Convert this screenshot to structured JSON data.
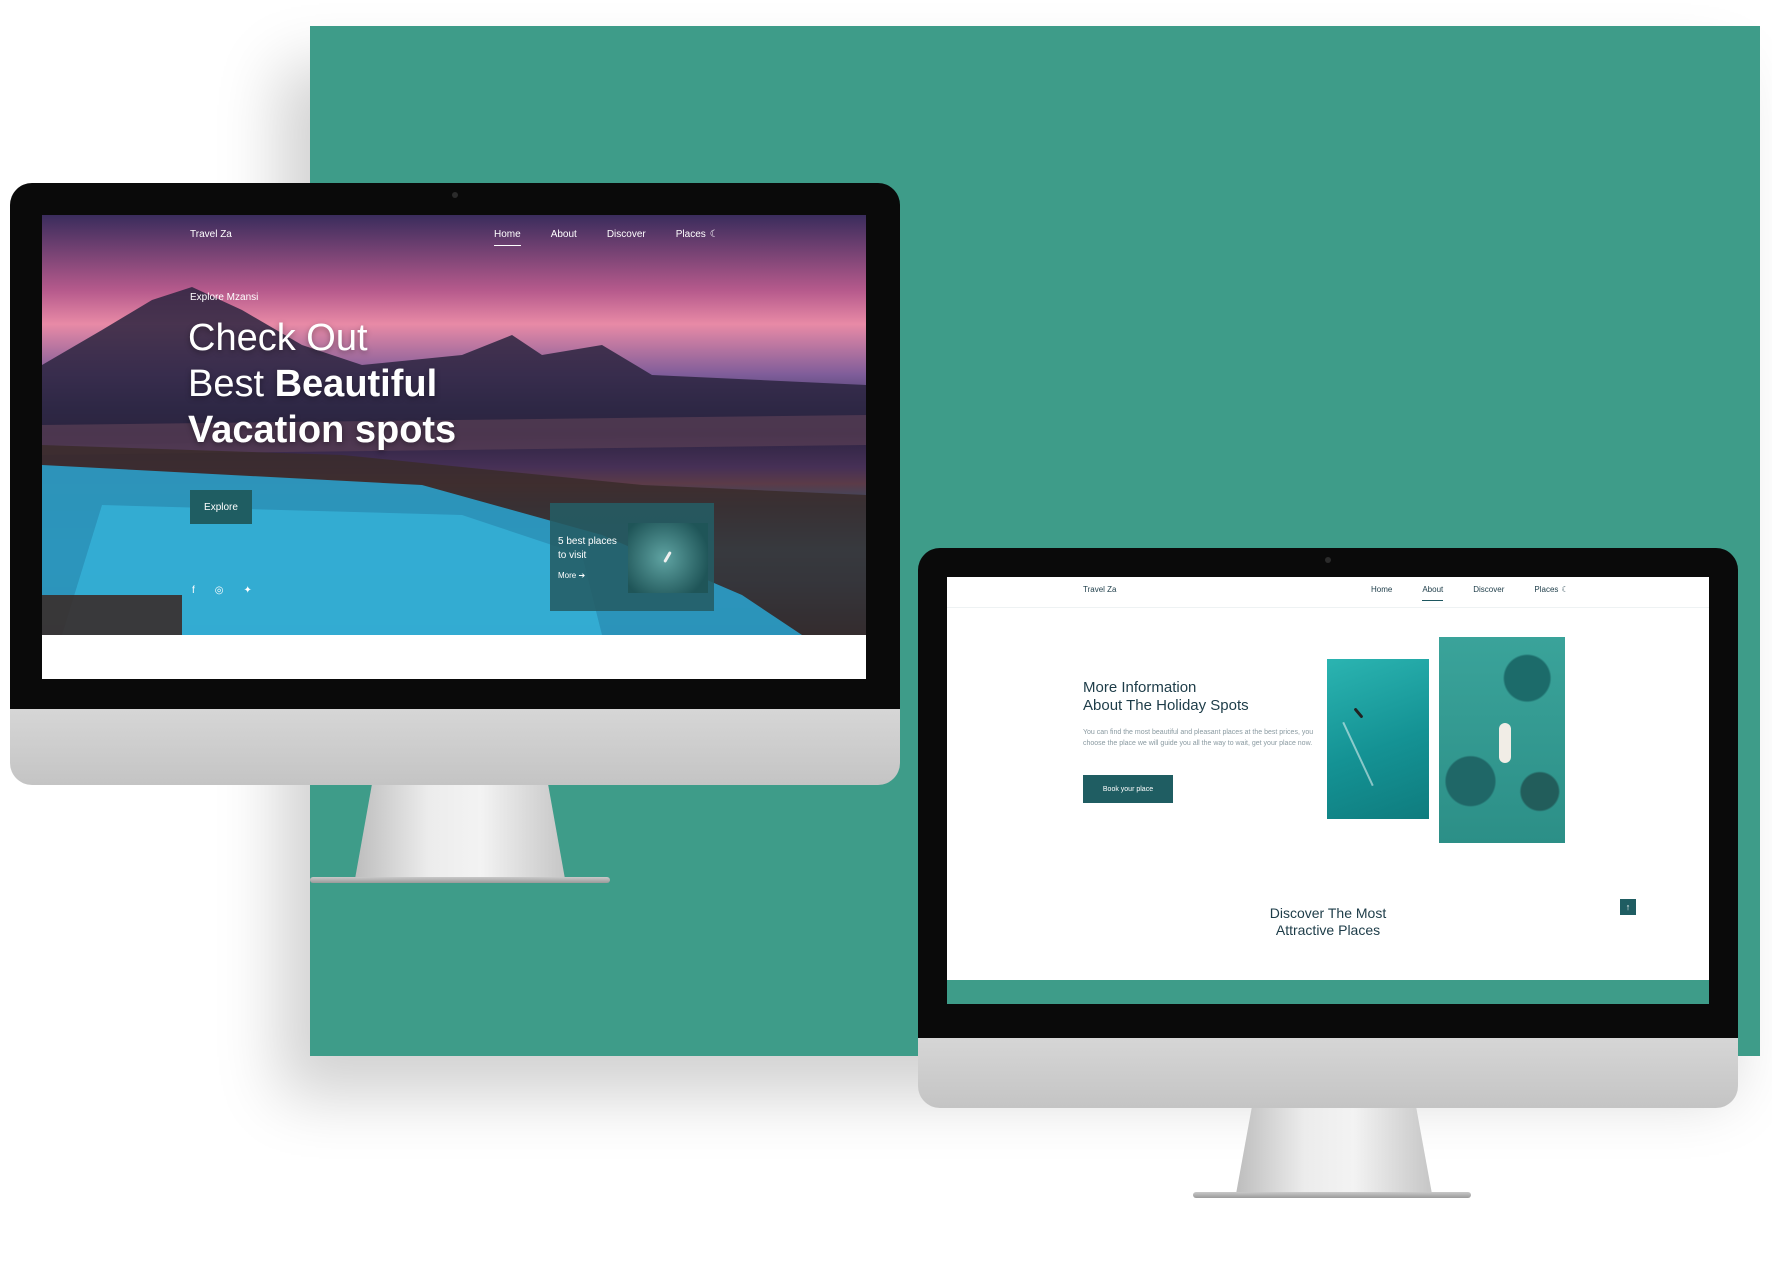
{
  "monitor1": {
    "brand": "Travel Za",
    "nav": [
      "Home",
      "About",
      "Discover",
      "Places"
    ],
    "active_nav": "Home",
    "eyebrow": "Explore Mzansi",
    "headline_line1": "Check Out",
    "headline_line2_light": "Best ",
    "headline_line2_bold": "Beautiful",
    "headline_line3": "Vacation spots",
    "explore_label": "Explore",
    "card_title": "5 best places to visit",
    "card_more": "More ➔",
    "social_icons": [
      "facebook-icon",
      "instagram-icon",
      "twitter-icon"
    ]
  },
  "monitor2": {
    "brand": "Travel Za",
    "nav": [
      "Home",
      "About",
      "Discover",
      "Places"
    ],
    "active_nav": "About",
    "title_line1": "More Information",
    "title_line2": "About The Holiday Spots",
    "body": "You can find the most beautiful and pleasant places at the best prices, you choose the place we will guide you all the way to wait, get your place now.",
    "book_label": "Book your place",
    "discover_line1": "Discover The Most",
    "discover_line2": "Attractive Places",
    "scroll_top_icon": "↑"
  },
  "colors": {
    "backdrop": "#3e9c89",
    "brand_dark": "#1f5d62",
    "text_dark": "#1d3c48"
  }
}
